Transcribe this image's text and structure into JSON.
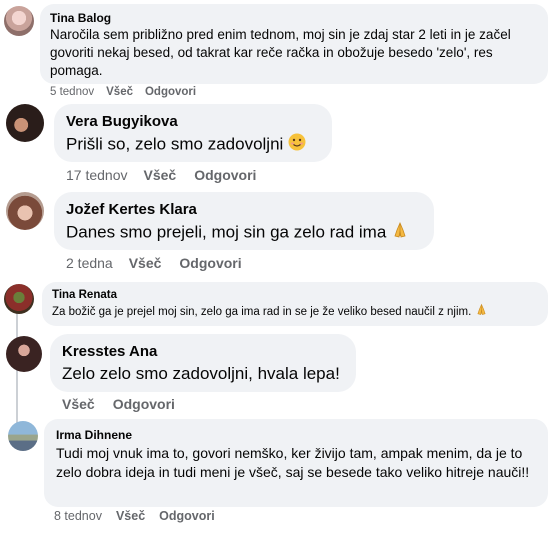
{
  "comments": [
    {
      "author": "Tina Balog",
      "text": "Naročila sem približno pred enim tednom, moj sin je zdaj star 2 leti in je začel govoriti nekaj besed, od takrat kar reče račka in obožuje besedo 'zelo', res pomaga.",
      "time": "5 tednov",
      "like_label": "Všeč",
      "reply_label": "Odgovori"
    },
    {
      "author": "Vera Bugyikova",
      "text": "Prišli so, zelo smo zadovoljni",
      "emoji": "smiling-face-emoji",
      "time": "17 tednov",
      "like_label": "Všeč",
      "reply_label": "Odgovori"
    },
    {
      "author": "Jožef Kertes Klara",
      "text": "Danes smo prejeli, moj sin ga zelo rad ima",
      "emoji": "folded-hands-emoji",
      "time": "2 tedna",
      "like_label": "Všeč",
      "reply_label": "Odgovori"
    },
    {
      "author": "Tina Renata",
      "text": "Za božič ga je prejel moj sin, zelo ga ima rad in se je že veliko besed naučil z njim.",
      "emoji": "folded-hands-emoji"
    },
    {
      "author": "Kresstes Ana",
      "text": "Zelo zelo smo zadovoljni, hvala lepa!",
      "like_label": "Všeč",
      "reply_label": "Odgovori"
    },
    {
      "author": "Irma Dihnene",
      "text": "Tudi moj vnuk ima to, govori nemško, ker živijo tam, ampak menim, da je to zelo dobra ideja in tudi meni je všeč, saj se besede tako veliko hitreje nauči!!",
      "time": "8 tednov",
      "like_label": "Všeč",
      "reply_label": "Odgovori"
    }
  ],
  "colors": {
    "bubble": "#f0f2f5",
    "secondary_text": "#65676b",
    "thread_line": "#ccd0d5"
  }
}
